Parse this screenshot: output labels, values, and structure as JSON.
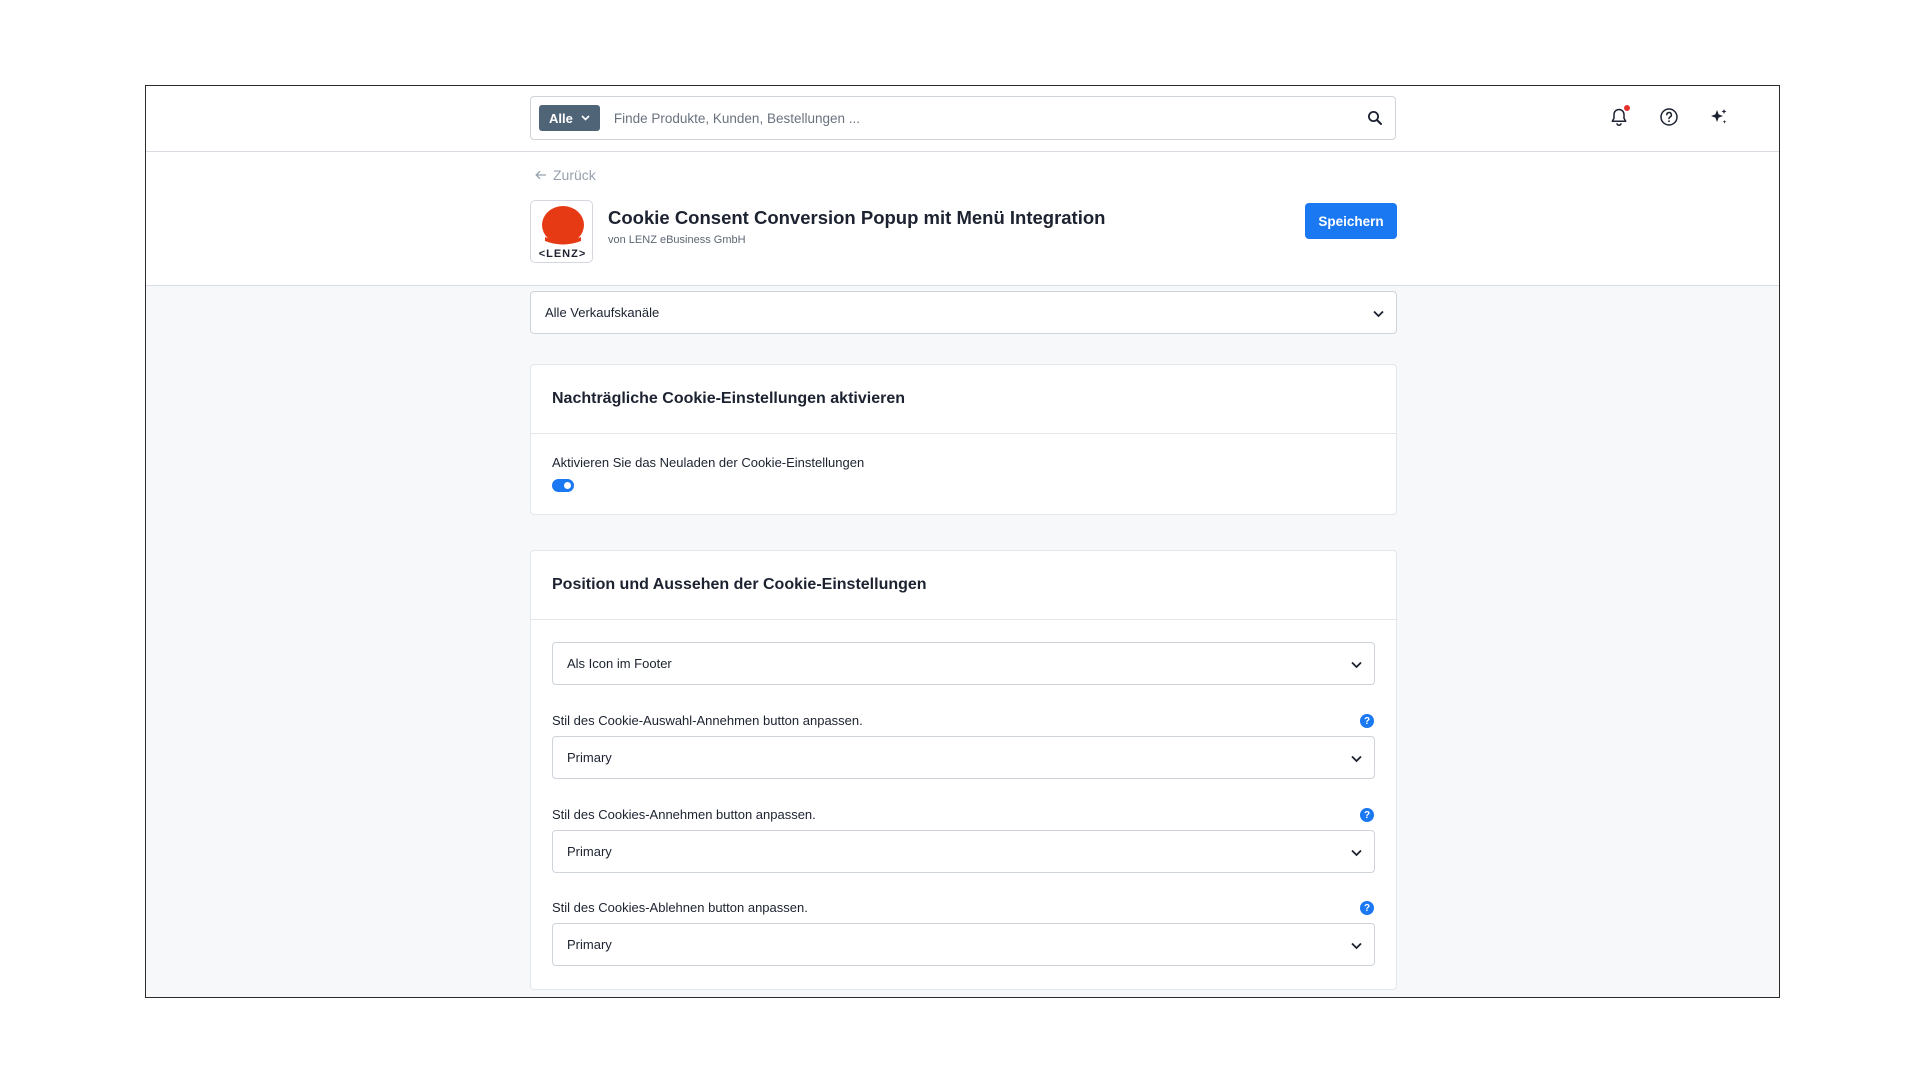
{
  "topbar": {
    "search": {
      "scope_label": "Alle",
      "placeholder": "Finde Produkte, Kunden, Bestellungen ..."
    },
    "icons": [
      "bell-icon",
      "help-circle-icon",
      "sparkle-icon"
    ]
  },
  "header": {
    "back_label": "Zurück",
    "logo_text": "<LENZ>",
    "title": "Cookie Consent Conversion Popup mit Menü Integration",
    "vendor": "von LENZ eBusiness GmbH",
    "save_label": "Speichern"
  },
  "channel_select": {
    "value": "Alle Verkaufskanäle"
  },
  "card_reload": {
    "title": "Nachträgliche Cookie-Einstellungen aktivieren",
    "toggle_label": "Aktivieren Sie das Neuladen der Cookie-Einstellungen",
    "toggle_on": true
  },
  "card_position": {
    "title": "Position und Aussehen der Cookie-Einstellungen",
    "position_value": "Als Icon im Footer",
    "fields": [
      {
        "label": "Stil des Cookie-Auswahl-Annehmen button anpassen.",
        "value": "Primary"
      },
      {
        "label": "Stil des Cookies-Annehmen button anpassen.",
        "value": "Primary"
      },
      {
        "label": "Stil des Cookies-Ablehnen button anpassen.",
        "value": "Primary"
      }
    ]
  },
  "colors": {
    "accent": "#1a78f2",
    "scope_bg": "#4f6577",
    "logo_red": "#e63a14"
  }
}
